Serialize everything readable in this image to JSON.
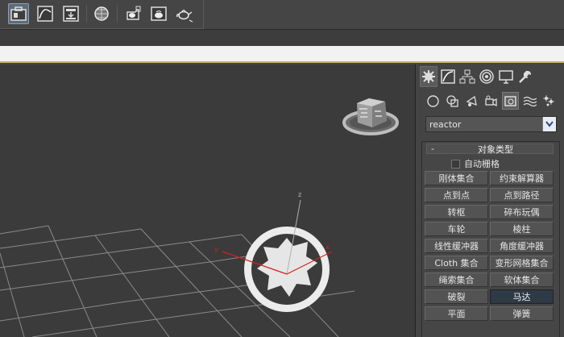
{
  "toolbar": {
    "buttons": [
      {
        "icon": "briefcase-icon",
        "active": true
      },
      {
        "icon": "curve-editor-icon",
        "active": false
      },
      {
        "icon": "schematic-view-icon",
        "active": false
      },
      {
        "icon": "material-editor-icon",
        "active": false
      },
      {
        "icon": "render-setup-icon",
        "active": false
      },
      {
        "icon": "rendered-frame-icon",
        "active": false
      },
      {
        "icon": "render-teapot-icon",
        "active": false
      }
    ]
  },
  "viewport": {
    "gizmo_axes": {
      "x": "x",
      "y": "y",
      "z": "z"
    }
  },
  "command_panel": {
    "tabs": [
      "create-tab",
      "modify-tab",
      "hierarchy-tab",
      "motion-tab",
      "display-tab",
      "utilities-tab"
    ],
    "subcategories": [
      "geometry",
      "shapes",
      "lights",
      "cameras",
      "helpers",
      "space-warps",
      "systems"
    ],
    "category": {
      "value": "reactor"
    },
    "rollout": {
      "minus": "-",
      "title": "对象类型",
      "autogrid_label": "自动栅格",
      "buttons": [
        {
          "label": "刚体集合",
          "active": false
        },
        {
          "label": "约束解算器",
          "active": false
        },
        {
          "label": "点到点",
          "active": false
        },
        {
          "label": "点到路径",
          "active": false
        },
        {
          "label": "转枢",
          "active": false
        },
        {
          "label": "碎布玩偶",
          "active": false
        },
        {
          "label": "车轮",
          "active": false
        },
        {
          "label": "棱柱",
          "active": false
        },
        {
          "label": "线性缓冲器",
          "active": false
        },
        {
          "label": "角度缓冲器",
          "active": false
        },
        {
          "label": "Cloth 集合",
          "active": false
        },
        {
          "label": "变形网格集合",
          "active": false
        },
        {
          "label": "绳索集合",
          "active": false
        },
        {
          "label": "软体集合",
          "active": false
        },
        {
          "label": "破裂",
          "active": false
        },
        {
          "label": "马达",
          "active": true
        },
        {
          "label": "平面",
          "active": false
        },
        {
          "label": "弹簧",
          "active": false
        }
      ]
    }
  },
  "colors": {
    "accent": "#c9b46d",
    "active_button": "#2f3a47",
    "axis_red": "#d42020"
  }
}
